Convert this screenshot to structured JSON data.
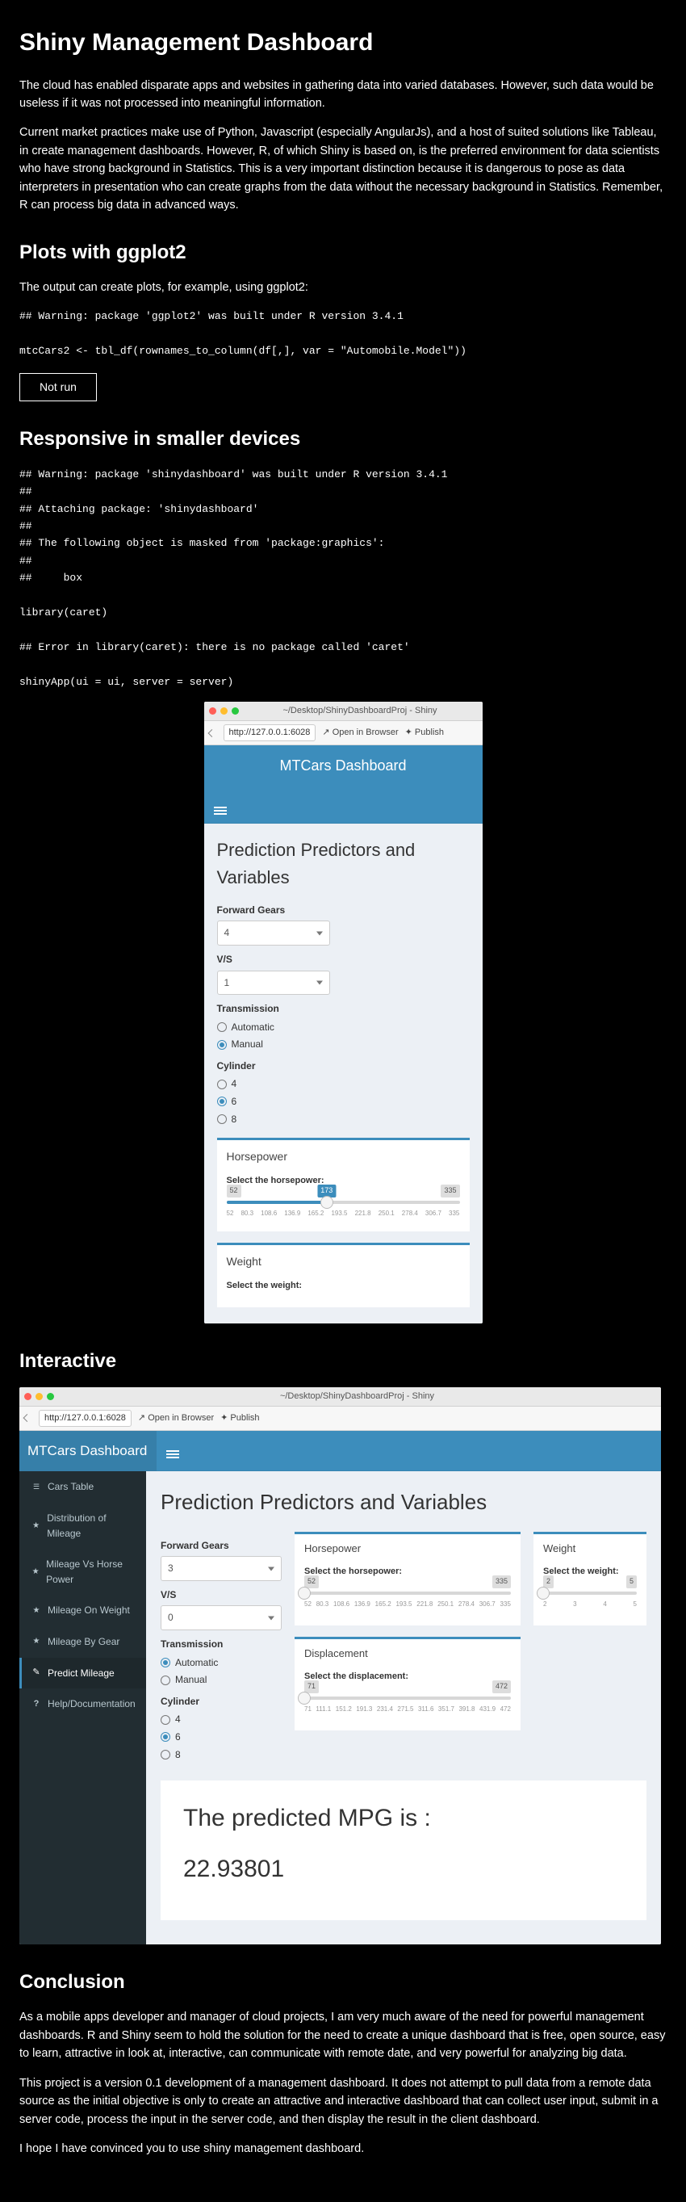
{
  "h1": "Shiny Management Dashboard",
  "p1": "The cloud has enabled disparate apps and websites in gathering data into varied databases. However, such data would be useless if it was not processed into meaningful information.",
  "p2": "Current market practices make use of Python, Javascript (especially AngularJs), and a host of suited solutions like Tableau, in create management dashboards. However, R, of which Shiny is based on, is the preferred environment for data scientists who have strong background in Statistics. This is a very important distinction because it is dangerous to pose as data interpreters in presentation who can create graphs from the data without the necessary background in Statistics. Remember, R can process big data in advanced ways.",
  "h_plots": "Plots with ggplot2",
  "p3": "The output can create plots, for example, using ggplot2:",
  "code1": "## Warning: package 'ggplot2' was built under R version 3.4.1\n\nmtcCars2 <- tbl_df(rownames_to_column(df[,], var = \"Automobile.Model\"))",
  "not_run": "Not run",
  "h_resp": "Responsive in smaller devices",
  "code2": "## Warning: package 'shinydashboard' was built under R version 3.4.1\n## \n## Attaching package: 'shinydashboard'\n## \n## The following object is masked from 'package:graphics':\n## \n##     box\n\nlibrary(caret)\n\n## Error in library(caret): there is no package called 'caret'\n\nshinyApp(ui = ui, server = server)",
  "h_inter": "Interactive",
  "h_conc": "Conclusion",
  "p_c1": "As a mobile apps developer and manager of cloud projects, I am very much aware of the need for powerful management dashboards. R and Shiny seem to hold the solution for the need to create a unique dashboard that is free, open source, easy to learn, attractive in look at, interactive, can communicate with remote date, and very powerful for analyzing big data.",
  "p_c2": "This project is a version 0.1 development of a management dashboard. It does not attempt to pull data from a remote data source as the initial objective is only to create an attractive and interactive dashboard that can collect user input, submit in a server code, process the input in the server code, and then display the result in the client dashboard.",
  "p_c3": "I hope I have convinced you to use shiny management dashboard.",
  "figA": {
    "titlebar": "~/Desktop/ShinyDashboardProj - Shiny",
    "url": "http://127.0.0.1:6028",
    "open": "Open in Browser",
    "publish": "Publish",
    "brand": "MTCars Dashboard",
    "headline": "Prediction Predictors and Variables",
    "fg_lbl": "Forward Gears",
    "fg_val": "4",
    "vs_lbl": "V/S",
    "vs_val": "1",
    "tr_lbl": "Transmission",
    "tr_auto": "Automatic",
    "tr_man": "Manual",
    "cy_lbl": "Cylinder",
    "cy4": "4",
    "cy6": "6",
    "cy8": "8",
    "hp_title": "Horsepower",
    "hp_sel": "Select the horsepower:",
    "hp_min": "52",
    "hp_val": "173",
    "hp_max": "335",
    "hp_ticks": [
      "52",
      "80.3",
      "108.6",
      "136.9",
      "165.2",
      "193.5",
      "221.8",
      "250.1",
      "278.4",
      "306.7",
      "335"
    ],
    "wt_title": "Weight",
    "wt_sel": "Select the weight:"
  },
  "figB": {
    "titlebar": "~/Desktop/ShinyDashboardProj - Shiny",
    "url": "http://127.0.0.1:6028",
    "open": "Open in Browser",
    "publish": "Publish",
    "brand": "MTCars Dashboard",
    "nav": [
      "Cars Table",
      "Distribution of Mileage",
      "Mileage Vs Horse Power",
      "Mileage On Weight",
      "Mileage By Gear",
      "Predict Mileage",
      "Help/Documentation"
    ],
    "headline": "Prediction Predictors and Variables",
    "fg_lbl": "Forward Gears",
    "fg_val": "3",
    "vs_lbl": "V/S",
    "vs_val": "0",
    "tr_lbl": "Transmission",
    "tr_auto": "Automatic",
    "tr_man": "Manual",
    "cy_lbl": "Cylinder",
    "cy4": "4",
    "cy6": "6",
    "cy8": "8",
    "hp_title": "Horsepower",
    "hp_sel": "Select the horsepower:",
    "hp_min": "52",
    "hp_max": "335",
    "hp_ticks": [
      "52",
      "80.3",
      "108.6",
      "136.9",
      "165.2",
      "193.5",
      "221.8",
      "250.1",
      "278.4",
      "306.7",
      "335"
    ],
    "wt_title": "Weight",
    "wt_sel": "Select the weight:",
    "wt_min": "2",
    "wt_max": "5",
    "wt_ticks": [
      "2",
      "3",
      "4",
      "5"
    ],
    "dp_title": "Displacement",
    "dp_sel": "Select the displacement:",
    "dp_min": "71",
    "dp_max": "472",
    "dp_ticks": [
      "71",
      "111.1",
      "151.2",
      "191.3",
      "231.4",
      "271.5",
      "311.6",
      "351.7",
      "391.8",
      "431.9",
      "472"
    ],
    "pred_lbl": "The predicted MPG is :",
    "pred_val": "22.93801"
  }
}
